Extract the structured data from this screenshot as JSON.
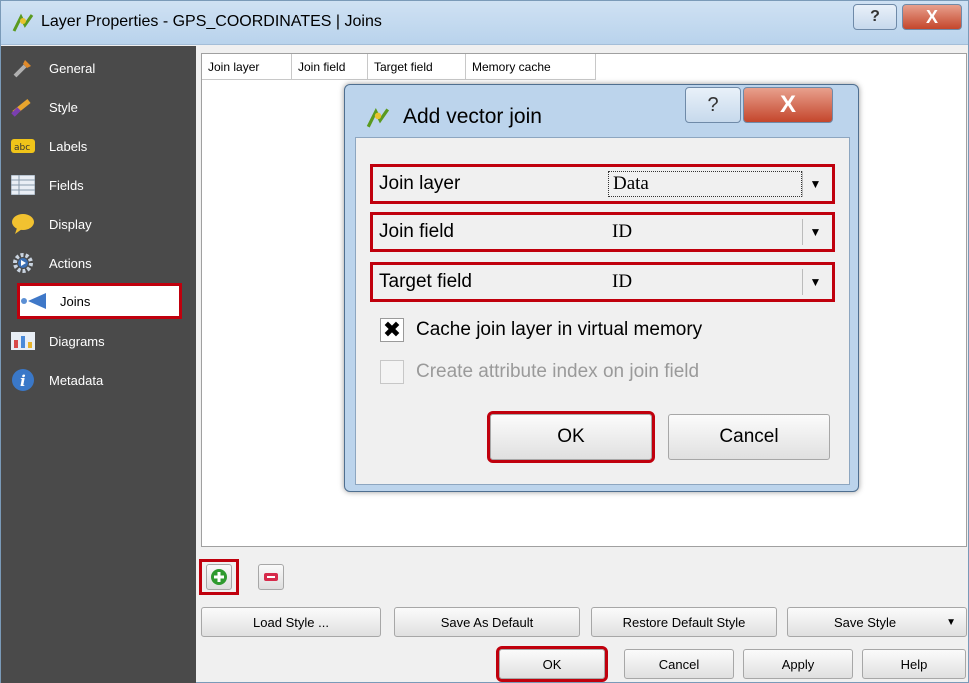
{
  "window": {
    "title": "Layer Properties - GPS_COORDINATES | Joins",
    "help_glyph": "?",
    "close_glyph": "X"
  },
  "sidebar": {
    "items": [
      {
        "label": "General",
        "icon": "wrench-icon"
      },
      {
        "label": "Style",
        "icon": "brush-icon"
      },
      {
        "label": "Labels",
        "icon": "abc-label-icon"
      },
      {
        "label": "Fields",
        "icon": "table-icon"
      },
      {
        "label": "Display",
        "icon": "speech-bubble-icon"
      },
      {
        "label": "Actions",
        "icon": "gear-icon"
      },
      {
        "label": "Joins",
        "icon": "join-icon"
      },
      {
        "label": "Diagrams",
        "icon": "chart-icon"
      },
      {
        "label": "Metadata",
        "icon": "info-icon"
      }
    ],
    "active": "Joins"
  },
  "joins_table": {
    "columns": [
      "Join layer",
      "Join field",
      "Target field",
      "Memory cache"
    ]
  },
  "bottom_buttons": {
    "load_style": "Load Style ...",
    "save_default": "Save As Default",
    "restore_default": "Restore Default Style",
    "save_style": "Save Style",
    "ok": "OK",
    "cancel": "Cancel",
    "apply": "Apply",
    "help": "Help"
  },
  "dialog": {
    "title": "Add vector join",
    "help_glyph": "?",
    "close_glyph": "X",
    "join_layer_label": "Join layer",
    "join_layer_value": "Data",
    "join_field_label": "Join field",
    "join_field_value": "ID",
    "target_field_label": "Target field",
    "target_field_value": "ID",
    "cache_label": "Cache join layer in virtual memory",
    "cache_checked": true,
    "index_label": "Create attribute index on join field",
    "index_checked": false,
    "ok": "OK",
    "cancel": "Cancel"
  },
  "colors": {
    "highlight": "#c0000d",
    "sidebar_bg": "#4a4a4a",
    "dialog_frame": "#bcd4ec"
  }
}
